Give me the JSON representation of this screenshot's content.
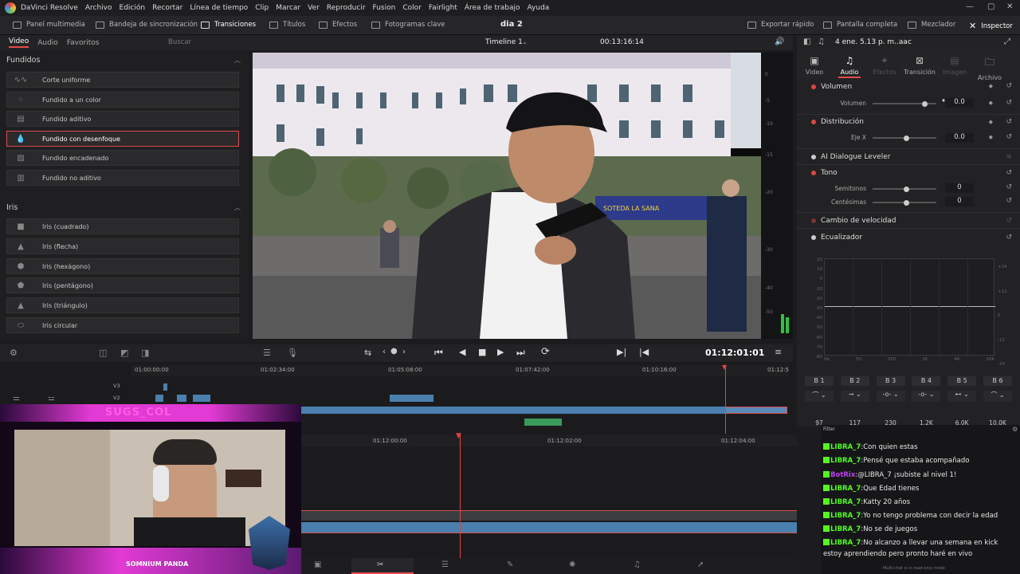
{
  "menubar": {
    "app": "DaVinci Resolve",
    "items": [
      "Archivo",
      "Edición",
      "Recortar",
      "Línea de tiempo",
      "Clip",
      "Marcar",
      "Ver",
      "Reproducir",
      "Fusion",
      "Color",
      "Fairlight",
      "Área de trabajo",
      "Ayuda"
    ]
  },
  "toolbar": {
    "media_pool": "Panel multimedia",
    "sync_bin": "Bandeja de sincronización",
    "transitions": "Transiciones",
    "titles": "Títulos",
    "effects": "Efectos",
    "keyframes": "Fotogramas clave",
    "project_title": "dia 2",
    "quick_export": "Exportar rápido",
    "fullscreen": "Pantalla completa",
    "mixer": "Mezclador",
    "inspector": "Inspector"
  },
  "effects_panel": {
    "tabs": [
      "Video",
      "Audio",
      "Favoritos"
    ],
    "search_placeholder": "Buscar",
    "section_dissolves": "Fundidos",
    "dissolves": [
      "Corte uniforme",
      "Fundido a un color",
      "Fundido aditivo",
      "Fundido con desenfoque",
      "Fundido encadenado",
      "Fundido no aditivo"
    ],
    "selected_index": 3,
    "section_iris": "Iris",
    "iris": [
      "Iris (cuadrado)",
      "Iris (flecha)",
      "Iris (hexágono)",
      "Iris (pentágono)",
      "Iris (triángulo)",
      "Iris circular"
    ]
  },
  "viewer": {
    "timeline_name": "Timeline 1",
    "source_timecode": "00:13:16:14",
    "timecode": "01:12:01:01",
    "banner_text": "SOTEDA LA SANA"
  },
  "meter_scale": [
    "0",
    "-5",
    "-10",
    "-15",
    "-20",
    "-30",
    "-40",
    "-50"
  ],
  "inspector": {
    "clip_name": "4 ene. 5.13 p. m..aac",
    "tabs": [
      {
        "label": "Video",
        "icon": "video-icon"
      },
      {
        "label": "Audio",
        "icon": "music-note-icon"
      },
      {
        "label": "Efectos",
        "icon": "effects-icon"
      },
      {
        "label": "Transición",
        "icon": "transition-icon"
      },
      {
        "label": "Imagen",
        "icon": "image-icon"
      },
      {
        "label": "Archivo",
        "icon": "file-icon"
      }
    ],
    "volume_header": "Volumen",
    "volume_label": "Volumen",
    "volume_value": "0.0",
    "pan_header": "Distribución",
    "pan_label": "Eje X",
    "pan_value": "0.0",
    "ai_leveler": "AI Dialogue Leveler",
    "pitch_header": "Tono",
    "semitones_label": "Semitonos",
    "semitones_value": "0",
    "cents_label": "Centésimas",
    "cents_value": "0",
    "speed_change": "Cambio de velocidad",
    "eq_header": "Ecualizador",
    "eq_y_left": [
      "20",
      "10",
      "0",
      "-10",
      "-20",
      "-30",
      "-40",
      "-50",
      "-60",
      "-70",
      "-80"
    ],
    "eq_y_right": [
      "+24",
      "+12",
      "0",
      "-12",
      "-24"
    ],
    "eq_x": [
      "Hz",
      "50",
      "250",
      "1K",
      "4K",
      "16K"
    ],
    "bands": [
      "B 1",
      "B 2",
      "B 3",
      "B 4",
      "B 5",
      "B 6"
    ],
    "band_values": [
      "97",
      "117",
      "230",
      "1.2K",
      "6.0K",
      "10.0K"
    ]
  },
  "timeline": {
    "ruler_top": [
      "01:00:00:00",
      "01:02:34:00",
      "01:05:08:00",
      "01:07:42:00",
      "01:10:16:00",
      "01:12:5"
    ],
    "track_labels": [
      "V3",
      "V2"
    ],
    "ruler_bottom": [
      "01:12:00:00",
      "01:12:02:00",
      "01:12:04:00"
    ]
  },
  "chat": {
    "filter_label": "Filter",
    "messages": [
      {
        "user": "LIBRA_7",
        "text": "Con quien estas",
        "bot": false
      },
      {
        "user": "LIBRA_7",
        "text": "Pensé que estaba acompañado",
        "bot": false
      },
      {
        "user": "BotRix",
        "text": "@LIBRA_7 ¡subiste al nivel 1!",
        "bot": true
      },
      {
        "user": "LIBRA_7",
        "text": "Que Edad tienes",
        "bot": false
      },
      {
        "user": "LIBRA_7",
        "text": "Katty 20 años",
        "bot": false
      },
      {
        "user": "LIBRA_7",
        "text": "Yo no tengo problema con decir la edad",
        "bot": false
      },
      {
        "user": "LIBRA_7",
        "text": "No se de juegos",
        "bot": false
      },
      {
        "user": "LIBRA_7",
        "text": "No alcanzo a llevar una semana en kick",
        "bot": false
      },
      {
        "user": "",
        "text": "estoy aprendiendo pero pronto haré en vivo",
        "bot": false
      }
    ],
    "footer": "Multi-chat is in read-only mode"
  },
  "stream_overlay": {
    "top_name": "SUGS_COL",
    "bottom_name": "SOMNIUM PANDA"
  },
  "colors": {
    "accent_red": "#e64b4b",
    "clip_blue": "#4a7fae",
    "clip_green": "#3a9a5a",
    "kick_green": "#53fc18",
    "bot_purple": "#c13ef4",
    "overlay_magenta": "#e23ad4"
  }
}
